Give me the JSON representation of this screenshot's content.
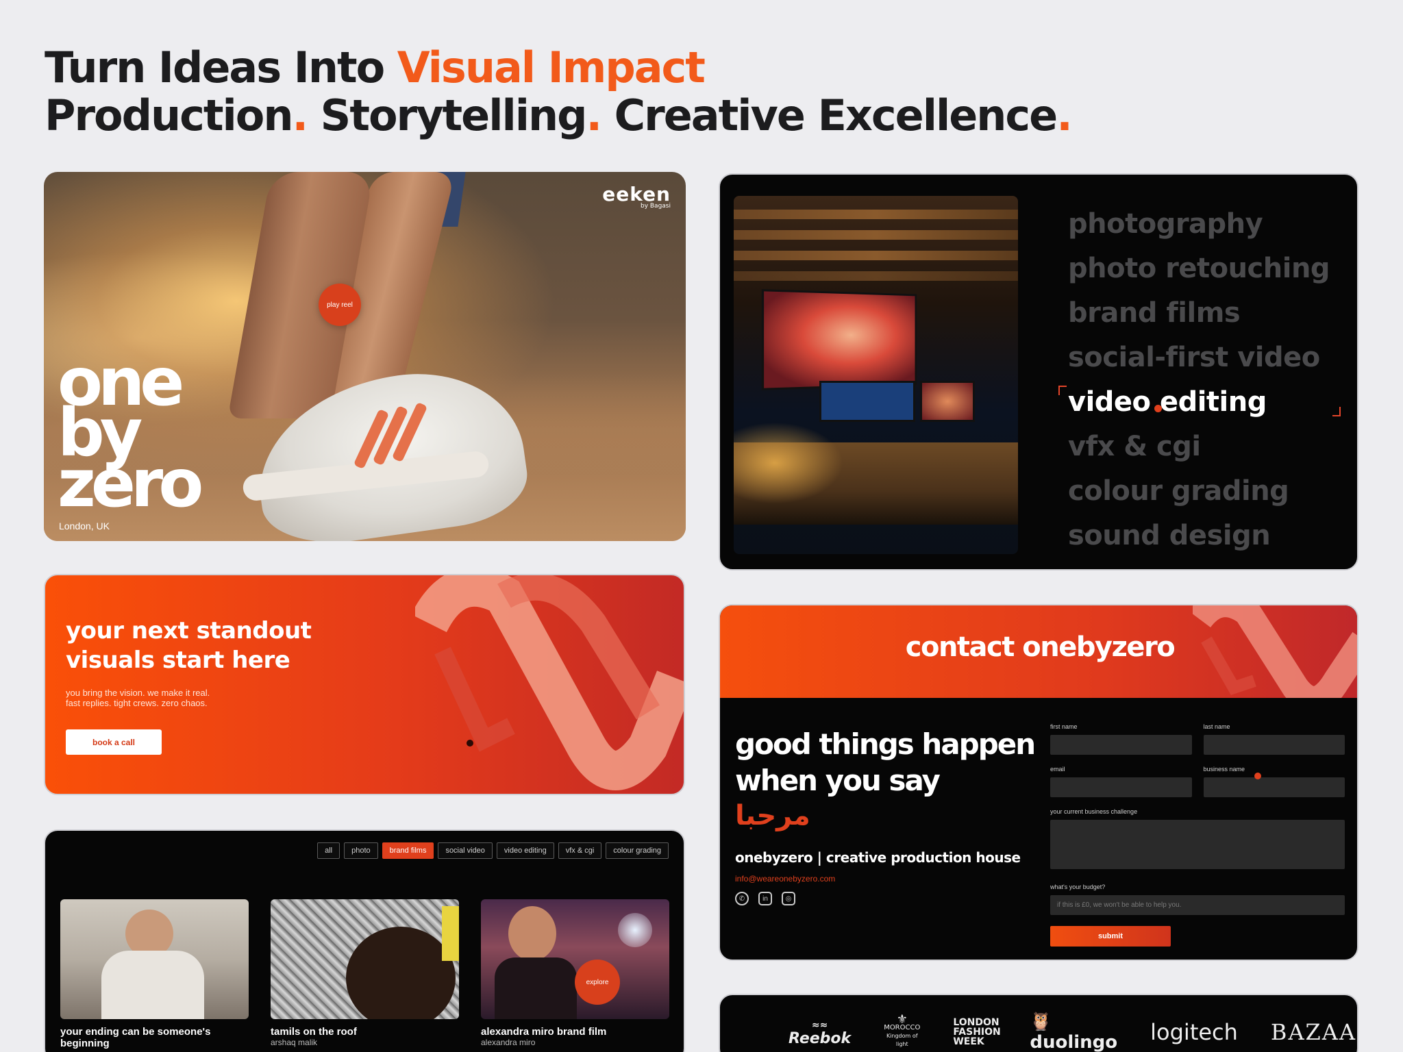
{
  "headline": {
    "line1_plain": "Turn Ideas Into ",
    "line1_accent": "Visual Impact",
    "line2_part1": "Production",
    "line2_part2": " Storytelling",
    "line2_part3": " Creative Excellence",
    "dot": "."
  },
  "hero": {
    "brand_tag": "eeken",
    "brand_tag_sub": "by Bagasi",
    "play_reel": "play reel",
    "logo_lines": [
      "one",
      "by",
      "zero"
    ],
    "location": "London, UK"
  },
  "services": {
    "items": [
      "photography",
      "photo retouching",
      "brand films",
      "social-first video",
      "video editing",
      "vfx & cgi",
      "colour grading",
      "sound design"
    ],
    "active_index": 4
  },
  "cta": {
    "title": "your next standout visuals start here",
    "line1": "you bring the vision. we make it real.",
    "line2": "fast replies. tight crews. zero chaos.",
    "button": "book a call"
  },
  "contact": {
    "title": "contact onebyzero",
    "tagline": "good things happen when you say",
    "arabic": "مرحبا",
    "company": "onebyzero | creative production house",
    "email": "info@weareonebyzero.com",
    "social": [
      "whatsapp-icon",
      "linkedin-icon",
      "instagram-icon"
    ],
    "form": {
      "first_name": "first name",
      "last_name": "last name",
      "email": "email",
      "business_name": "business name",
      "challenge": "your current business challenge",
      "budget": "what's your budget?",
      "budget_placeholder": "if this is £0, we won't be able to help you.",
      "submit": "submit"
    }
  },
  "portfolio": {
    "filters": [
      "all",
      "photo",
      "brand films",
      "social video",
      "video editing",
      "vfx & cgi",
      "colour grading"
    ],
    "active_filter": "brand films",
    "cards": [
      {
        "title": "your ending can be someone's beginning",
        "subtitle": ""
      },
      {
        "title": "tamils on the roof",
        "subtitle": "arshaq malik"
      },
      {
        "title": "alexandra miro brand film",
        "subtitle": "alexandra miro"
      }
    ],
    "explore": "explore"
  },
  "logos": {
    "items": [
      "Reebok",
      "MOROCCO",
      "Kingdom of light",
      "LONDON FASHION WEEK",
      "duolingo",
      "logitech",
      "BAZAAR"
    ]
  },
  "colors": {
    "accent": "#f25a1a",
    "dark_bg": "#060606",
    "light_bg": "#ededf0"
  }
}
